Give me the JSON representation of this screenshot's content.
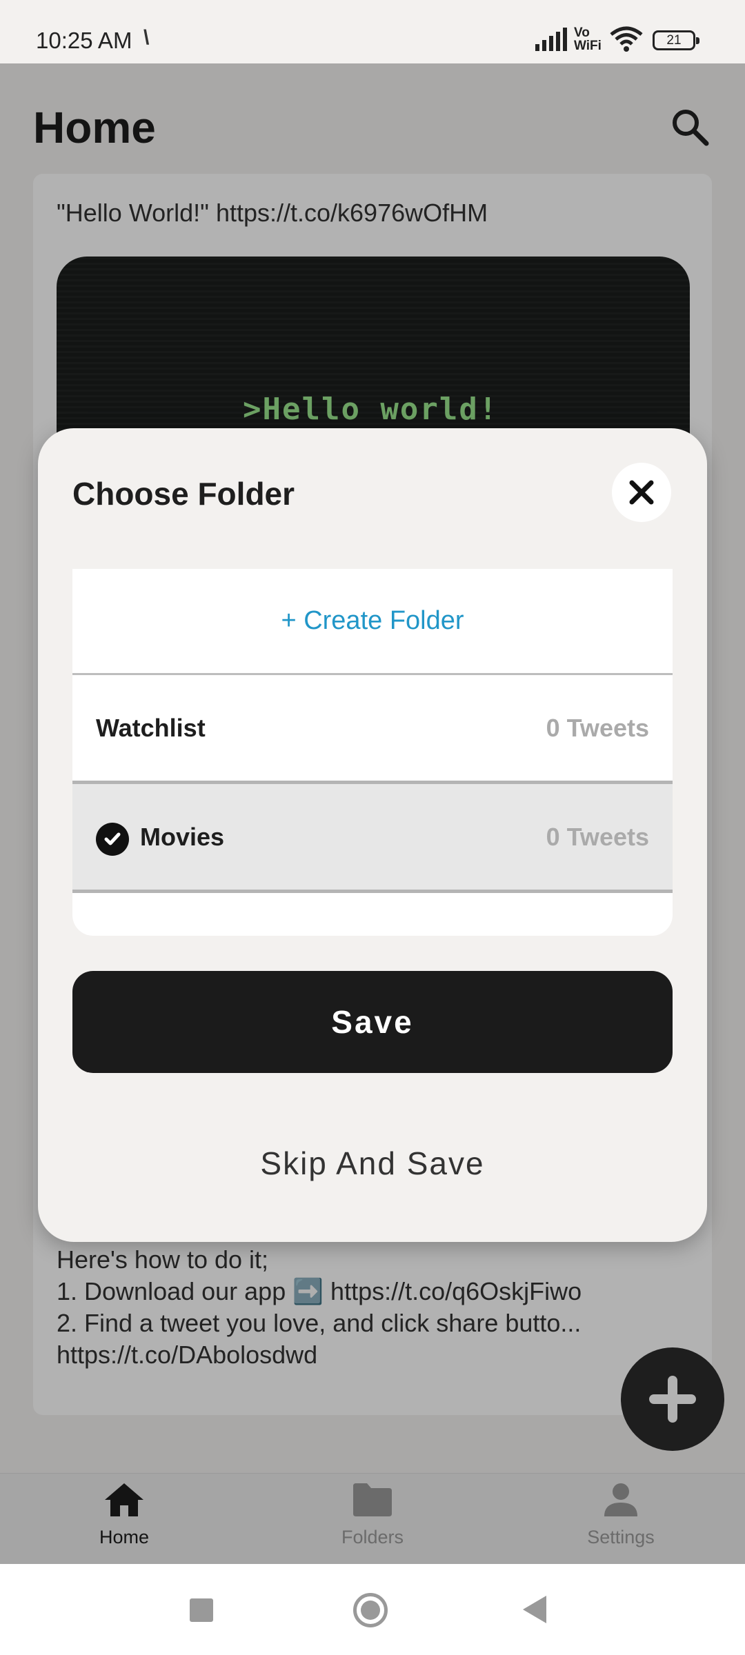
{
  "status_bar": {
    "time": "10:25 AM",
    "network_glyph": "\\",
    "vowifi_top": "Vo",
    "vowifi_bottom": "WiFi",
    "battery": "21"
  },
  "header": {
    "title": "Home",
    "search_icon": "search-icon"
  },
  "feed": {
    "tweet_text": "\"Hello World!\" https://t.co/k6976wOfHM",
    "media_text": ">Hello world!",
    "bottom_lines": [
      "Here's how to do it;",
      "1. Download our app ➡️ https://t.co/q6OskjFiwo",
      "2. Find a tweet you love, and click share butto...",
      "https://t.co/DAbolosdwd"
    ],
    "fab_icon": "plus-icon"
  },
  "modal": {
    "title": "Choose Folder",
    "close_icon": "close-icon",
    "create_label": "+ Create Folder",
    "folders": [
      {
        "name": "Watchlist",
        "count": "0 Tweets",
        "selected": false
      },
      {
        "name": "Movies",
        "count": "0 Tweets",
        "selected": true
      }
    ],
    "save_label": "Save",
    "skip_label": "Skip And Save"
  },
  "bottom_nav": {
    "items": [
      {
        "label": "Home",
        "icon": "home-icon",
        "active": true
      },
      {
        "label": "Folders",
        "icon": "folder-icon",
        "active": false
      },
      {
        "label": "Settings",
        "icon": "person-icon",
        "active": false
      }
    ]
  },
  "colors": {
    "accent_link": "#2196c8",
    "primary_button": "#1b1b1b",
    "background": "#f3f1ef"
  }
}
